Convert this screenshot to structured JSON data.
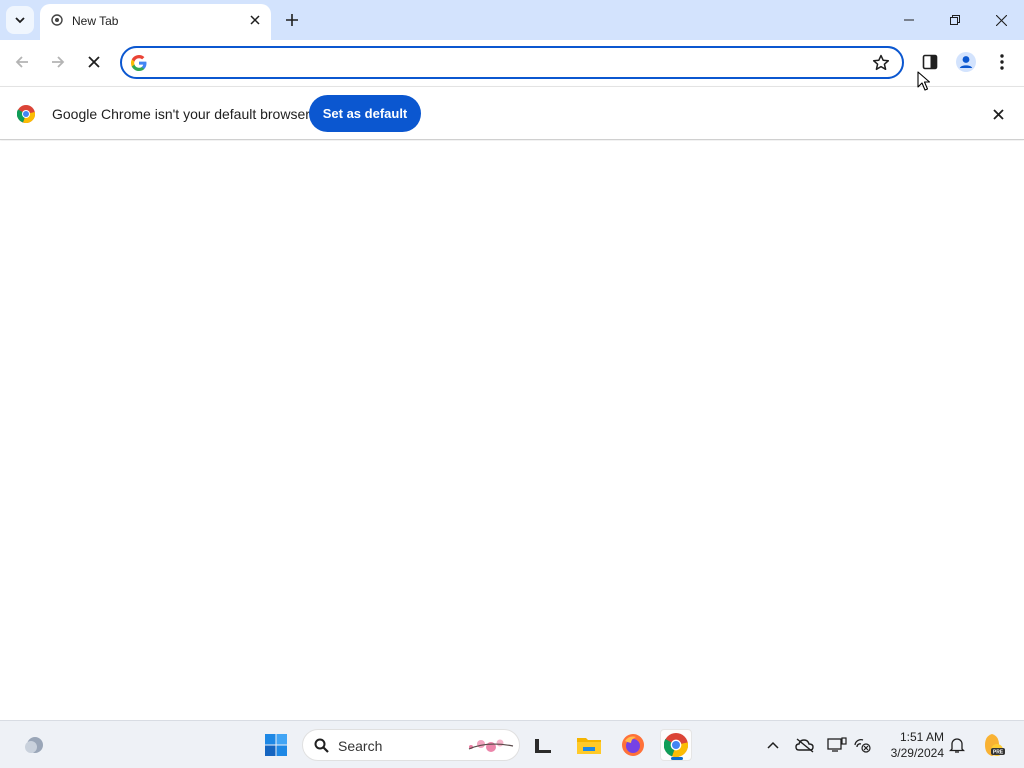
{
  "browser": {
    "tab": {
      "title": "New Tab"
    },
    "omnibox": {
      "value": "",
      "placeholder": ""
    },
    "infobar": {
      "message": "Google Chrome isn't your default browser",
      "button_label": "Set as default"
    }
  },
  "taskbar": {
    "search_placeholder": "Search",
    "clock": {
      "time": "1:51 AM",
      "date": "3/29/2024"
    }
  },
  "colors": {
    "titlebar": "#d3e3fd",
    "accent": "#0b57d0",
    "taskbar": "#eef1f6"
  },
  "icons": [
    "tab-search-icon",
    "new-tab-favicon",
    "close-icon",
    "plus-icon",
    "minimize-icon",
    "restore-icon",
    "back-icon",
    "forward-icon",
    "stop-icon",
    "google-g-icon",
    "star-icon",
    "side-panel-icon",
    "profile-icon",
    "kebab-menu-icon",
    "chrome-logo-icon",
    "weather-icon",
    "windows-start-icon",
    "search-icon",
    "file-explorer-icon",
    "firefox-icon",
    "chrome-icon",
    "chevron-up-icon",
    "onedrive-icon",
    "display-icon",
    "network-icon",
    "bell-icon",
    "copilot-icon"
  ]
}
